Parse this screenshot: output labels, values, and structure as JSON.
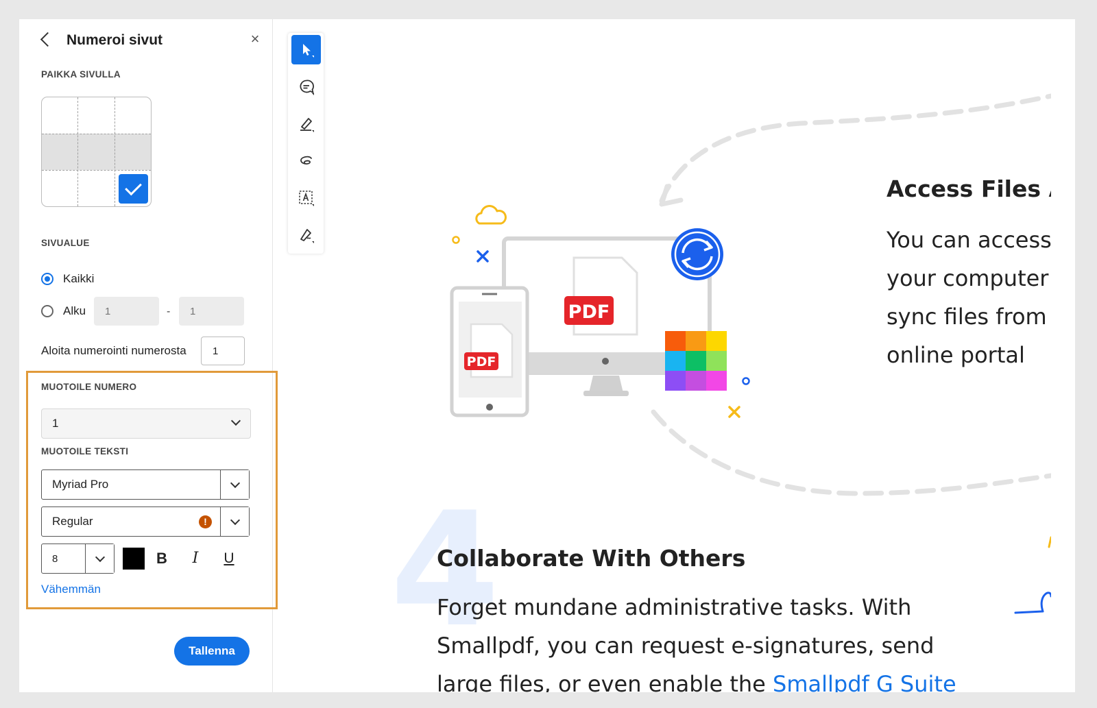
{
  "panel": {
    "title": "Numeroi sivut",
    "back_icon": "chevron-left-icon",
    "close_label": "×",
    "position_label": "PAIKKA SIVULLA",
    "range_label": "SIVUALUE",
    "range_all_label": "Kaikki",
    "range_start_label": "Alku",
    "range_from_placeholder": "1",
    "range_to_placeholder": "1",
    "range_dash": "-",
    "start_number_label": "Aloita numerointi numerosta",
    "start_number_value": "1",
    "format_number_label": "MUOTOILE NUMERO",
    "format_number_value": "1",
    "format_text_label": "MUOTOILE TEKSTI",
    "font_family": "Myriad Pro",
    "font_style": "Regular",
    "font_style_warning": "!",
    "font_size": "8",
    "bold_label": "B",
    "italic_label": "I",
    "underline_label": "U",
    "less_link": "Vähemmän",
    "save_label": "Tallenna"
  },
  "toolrail": {
    "tools": [
      "select-tool",
      "comment-tool",
      "highlight-tool",
      "draw-tool",
      "text-tool",
      "sign-tool"
    ]
  },
  "document": {
    "access_heading": "Access Files Ar",
    "access_lines": [
      "You can access",
      "your computer",
      "sync files from",
      "online portal"
    ],
    "pdf_label": "PDF",
    "big_number": "4",
    "collab_heading": "Collaborate With Others",
    "collab_line1": "Forget mundane administrative tasks. With",
    "collab_line2": "Smallpdf, you can request e-signatures, send",
    "collab_line3_prefix": "large files, or even enable the ",
    "collab_line3_link": "Smallpdf G Suite"
  },
  "colors": {
    "accent": "#1473e6",
    "highlight_border": "#e19a3a",
    "pdf_red": "#e5252a",
    "text_color": "#000000"
  }
}
